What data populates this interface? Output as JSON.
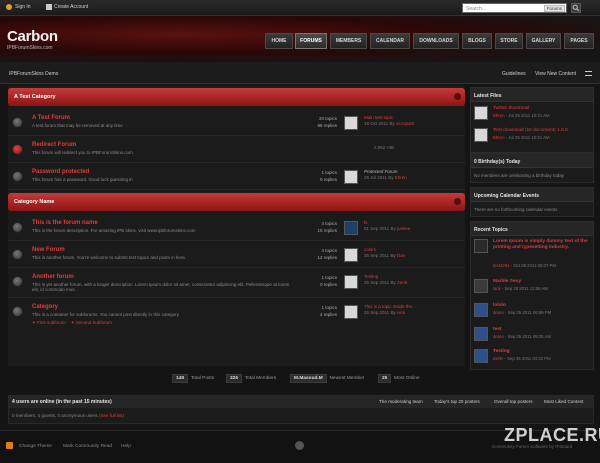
{
  "topbar": {
    "sign_in": "Sign In",
    "create_account": "Create Account",
    "search_placeholder": "Search...",
    "search_scope": "Forums"
  },
  "header": {
    "title": "Carbon",
    "subtitle": "IPBForumSkins.com",
    "nav": [
      "HOME",
      "FORUMS",
      "MEMBERS",
      "CALENDAR",
      "DOWNLOADS",
      "BLOGS",
      "STORE",
      "GALLERY",
      "PAGES"
    ],
    "active_tab": "FORUMS"
  },
  "subbar": {
    "breadcrumb": "IPBForumSkins Demo",
    "guidelines": "Guidelines",
    "view_new": "View New Content"
  },
  "categories": [
    {
      "name": "A Test Category",
      "forums": [
        {
          "title": "A Test Forum",
          "desc": "A test forum that may be removed at any time",
          "topics": "20 topics",
          "replies": "86 replies",
          "last_title": "Main test topic",
          "last_date": "19 Oct 2011",
          "last_by": "By",
          "last_user": "occupant",
          "icon": "gray"
        },
        {
          "title": "Redirect Forum",
          "desc": "This forum will redirect you to IPBForumSkins.com",
          "topics": "",
          "replies": "",
          "last_title": "2,952 Hits",
          "last_date": "",
          "last_by": "",
          "last_user": "",
          "icon": "red"
        },
        {
          "title": "Password protected",
          "desc": "This forum has a password. Good luck guessing it!",
          "topics": "1 topics",
          "replies": "0 replies",
          "last_title": "Protected Forum",
          "last_date": "25 Jul 2011",
          "last_by": "By",
          "last_user": "Ehren",
          "icon": "gray"
        }
      ]
    },
    {
      "name": "Category Name",
      "forums": [
        {
          "title": "This is the forum name",
          "desc": "This is the forum description. For amazing IPB skins, visit www.ipbforumskins.com",
          "topics": "4 topics",
          "replies": "15 replies",
          "last_title": "fx",
          "last_date": "01 Sep 2011",
          "last_by": "By",
          "last_user": "junkee",
          "icon": "gray"
        },
        {
          "title": "New Forum",
          "desc": "This is another forum. You're welcome to submit test topics and posts in here.",
          "topics": "4 topics",
          "replies": "12 replies",
          "last_title": "colors",
          "last_date": "26 Sep 2011",
          "last_by": "By",
          "last_user": "Dav",
          "icon": "gray"
        },
        {
          "title": "Another forum",
          "desc": "This is yet another forum, with a longer description. Lorem ipsum dolor sit amet, consectetur adipiscing elit. Pellentesque at lorem elit, id commodo mus.",
          "topics": "1 topics",
          "replies": "0 replies",
          "last_title": "Testing",
          "last_date": "25 Sep 2011",
          "last_by": "By",
          "last_user": "ZeriK",
          "icon": "gray"
        },
        {
          "title": "Category",
          "desc": "This is a container for subforums. You cannot post directly in this category.",
          "topics": "1 topics",
          "replies": "4 replies",
          "last_title": "This is a topic inside the...",
          "last_date": "25 Sep 2011",
          "last_by": "By",
          "last_user": "nick",
          "icon": "gray"
        }
      ],
      "subforums": [
        "First subforum",
        "Second Subforum"
      ]
    }
  ],
  "sidebar": {
    "latest_files": {
      "title": "Latest Files",
      "items": [
        {
          "name": "Twitter thumbnail",
          "user": "Ehren",
          "date": "Jul 25 2011 10:41 AM"
        },
        {
          "name": "Test download (txt document) 1.0.0",
          "user": "Ehren",
          "date": "Jul 25 2011 10:21 AM"
        }
      ]
    },
    "birthdays": {
      "title": "0 Birthday(s) Today",
      "text": "No members are celebrating a birthday today"
    },
    "events": {
      "title": "Upcoming Calendar Events",
      "text": "There are no forthcoming calendar events"
    },
    "recent": {
      "title": "Recent Topics",
      "items": [
        {
          "name": "Lorem Ipsum is simply dummy text of the printing and typesetting industry.",
          "user": "test4291",
          "date": "Oct 08 2011 06:07 PM"
        },
        {
          "name": "Marble Sexy",
          "user": "lack",
          "date": "Sep 28 2011 12:58 AM"
        },
        {
          "name": "lololo",
          "user": "demo",
          "date": "Sep 25 2011 06:59 PM"
        },
        {
          "name": "test",
          "user": "demo",
          "date": "Sep 25 2011 05:25 AM"
        },
        {
          "name": "Testing",
          "user": "ZeriK",
          "date": "Sep 25 2011 04:32 PM"
        }
      ]
    }
  },
  "stats": {
    "total_posts": "148",
    "total_posts_label": "Total Posts",
    "total_members": "326",
    "total_members_label": "Total Members",
    "newest": "M.Masoud.M",
    "newest_label": "Newest Member",
    "most_online": "25",
    "most_online_label": "Most Online"
  },
  "online": {
    "title": "4 users are online (in the past 15 minutes)",
    "links": [
      "The moderating team",
      "Today's top 20 posters",
      "Overall top posters",
      "Most Liked Content"
    ],
    "summary": "0 members, 4 guests, 0 anonymous users",
    "full_list": "(See full list)"
  },
  "footer": {
    "change_theme": "Change Theme",
    "mark_read": "Mark Community Read",
    "help": "Help",
    "copyright": "Community Forum Software by IP.Board"
  },
  "watermark": "ZPLACE.RU"
}
